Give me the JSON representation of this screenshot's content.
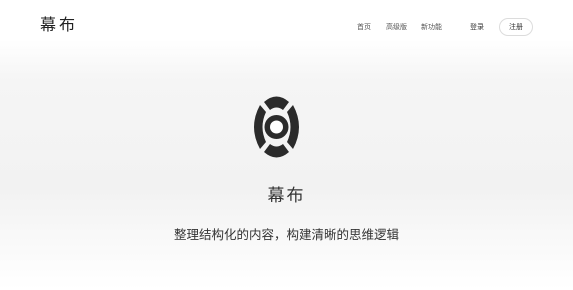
{
  "header": {
    "logo": "幕布",
    "nav": [
      {
        "label": "首页"
      },
      {
        "label": "高级版"
      },
      {
        "label": "新功能"
      }
    ],
    "login_label": "登录",
    "register_label": "注册"
  },
  "hero": {
    "icon": "mubu-logo-icon",
    "brand_name": "幕布",
    "tagline": "整理结构化的内容，构建清晰的思维逻辑"
  },
  "colors": {
    "logo_dark": "#2b2b2b",
    "text": "#333333",
    "background": "#f3f3f3"
  }
}
